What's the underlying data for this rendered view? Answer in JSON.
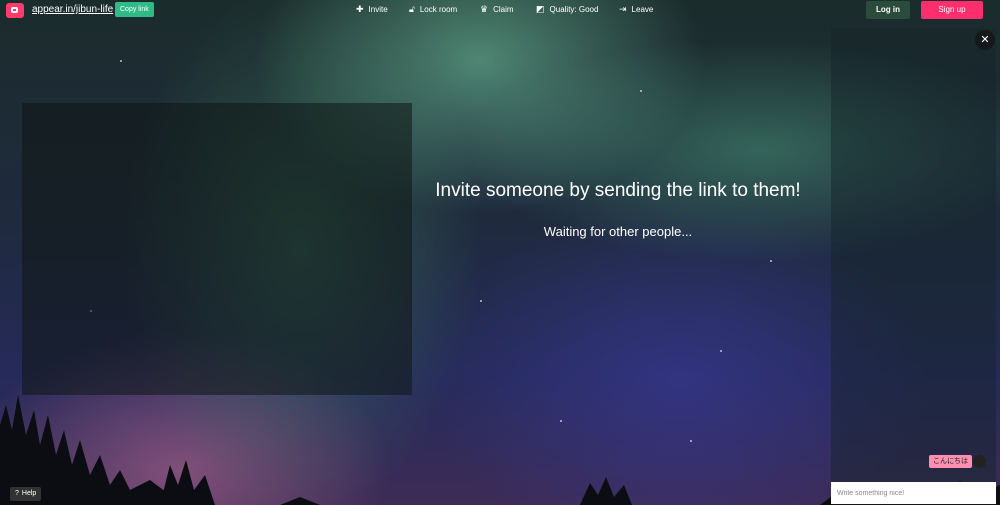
{
  "room": {
    "url": "appear.in/jibun-life",
    "copy_label": "Copy link"
  },
  "nav": [
    {
      "icon": "plus-icon",
      "label": "Invite"
    },
    {
      "icon": "lock-icon",
      "label": "Lock room"
    },
    {
      "icon": "crown-icon",
      "label": "Claim"
    },
    {
      "icon": "quality-icon",
      "label": "Quality: Good"
    },
    {
      "icon": "exit-icon",
      "label": "Leave"
    }
  ],
  "account": {
    "login_label": "Log in",
    "signup_label": "Sign up"
  },
  "main": {
    "heading": "Invite someone by sending the link to them!",
    "status": "Waiting for other people..."
  },
  "chat": {
    "bubble_text": "こんにちは",
    "input_placeholder": "Write something nice!"
  },
  "help": {
    "label": "Help"
  },
  "colors": {
    "brand": "#ff3b6b",
    "copy_button": "#2fbb88",
    "login_button": "#2a4c3c",
    "signup_button": "#ff2f6d"
  }
}
